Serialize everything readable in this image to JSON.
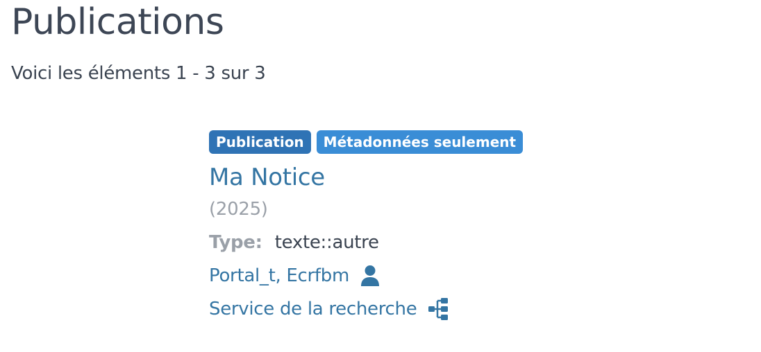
{
  "header": {
    "title": "Publications",
    "summary": "Voici les éléments 1 - 3 sur 3"
  },
  "result": {
    "badges": {
      "type": "Publication",
      "access": "Métadonnées seulement"
    },
    "title": "Ma Notice",
    "year": "(2025)",
    "type_label": "Type:",
    "type_value": "texte::autre",
    "authors": "Portal_t, Ecrfbm",
    "author_icon": "person-icon",
    "organization": "Service de la recherche",
    "organization_icon": "hierarchy-icon"
  },
  "colors": {
    "badge_publication": "#2f73b5",
    "badge_metadata": "#3a8dd6",
    "link": "#3475a3",
    "muted": "#9aa0a8",
    "text": "#3a4350"
  }
}
